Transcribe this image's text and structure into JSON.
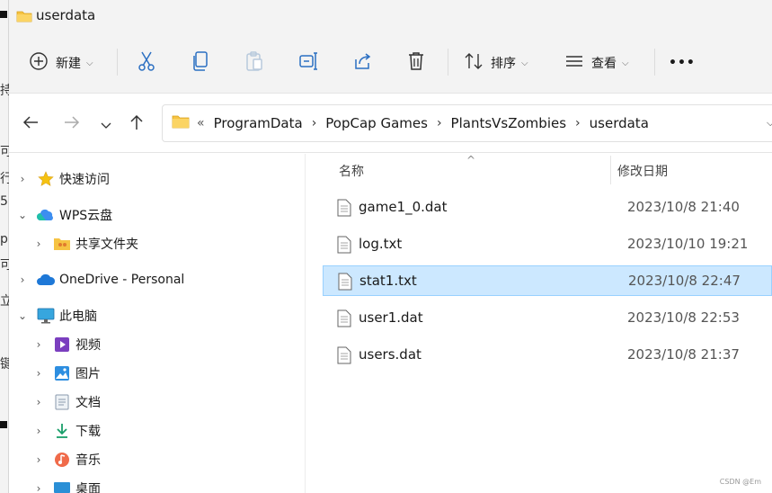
{
  "title": "userdata",
  "toolbar": {
    "new_label": "新建",
    "sort_label": "排序",
    "view_label": "查看",
    "more_label": "•••"
  },
  "address": {
    "prefix": "«",
    "crumbs": [
      "ProgramData",
      "PopCap Games",
      "PlantsVsZombies",
      "userdata"
    ]
  },
  "nav": {
    "items": [
      {
        "label": "快速访问"
      },
      {
        "label": "WPS云盘"
      },
      {
        "label": "共享文件夹"
      },
      {
        "label": "OneDrive - Personal"
      },
      {
        "label": "此电脑"
      },
      {
        "label": "视频"
      },
      {
        "label": "图片"
      },
      {
        "label": "文档"
      },
      {
        "label": "下载"
      },
      {
        "label": "音乐"
      },
      {
        "label": "桌面"
      }
    ]
  },
  "columns": {
    "name": "名称",
    "date": "修改日期"
  },
  "files": [
    {
      "name": "game1_0.dat",
      "date": "2023/10/8 21:40"
    },
    {
      "name": "log.txt",
      "date": "2023/10/10 19:21"
    },
    {
      "name": "stat1.txt",
      "date": "2023/10/8 22:47"
    },
    {
      "name": "user1.dat",
      "date": "2023/10/8 22:53"
    },
    {
      "name": "users.dat",
      "date": "2023/10/8 21:37"
    }
  ],
  "selected_file": "stat1.txt",
  "watermark": "CSDN @Em",
  "background_fragments": [
    "持",
    "可",
    "行",
    "5",
    "p",
    "可",
    "立",
    "键"
  ],
  "colors": {
    "accent": "#0067c0",
    "selection": "#cce8ff",
    "folder": "#f6c343"
  }
}
